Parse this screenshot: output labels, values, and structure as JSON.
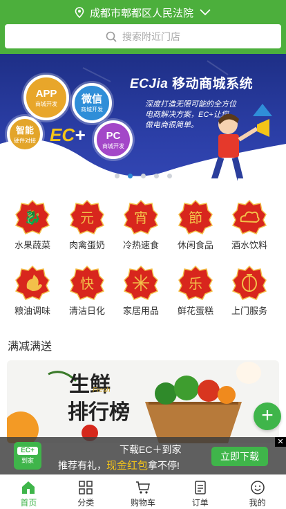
{
  "header": {
    "location": "成都市郫都区人民法院",
    "search_placeholder": "搜索附近门店"
  },
  "banner": {
    "brand": "ECJia",
    "title": "移动商城系统",
    "desc_line1": "深度打造无限可能的全方位",
    "desc_line2": "电商解决方案，EC+让您",
    "desc_line3": "做电商很简单。",
    "logo_text": "EC",
    "bubbles": [
      {
        "big": "APP",
        "small": "商城开发",
        "color": "#e8a62a"
      },
      {
        "big": "微信",
        "small": "商城开发",
        "color": "#2f8ed8"
      },
      {
        "big": "智能",
        "small": "硬件对接",
        "color": "#e3a52a"
      },
      {
        "big": "PC",
        "small": "商城开发",
        "color": "#a347c8"
      }
    ],
    "slide_count": 5,
    "active_slide": 1
  },
  "categories": [
    {
      "label": "水果蔬菜",
      "glyph": "🐉"
    },
    {
      "label": "肉禽蛋奶",
      "glyph": "元"
    },
    {
      "label": "冷热速食",
      "glyph": "宵"
    },
    {
      "label": "休闲食品",
      "glyph": "節"
    },
    {
      "label": "酒水饮料",
      "glyph": "☁"
    },
    {
      "label": "粮油调味",
      "glyph": "🐓"
    },
    {
      "label": "清洁日化",
      "glyph": "快"
    },
    {
      "label": "家居用品",
      "glyph": "✺"
    },
    {
      "label": "鲜花蛋糕",
      "glyph": "乐"
    },
    {
      "label": "上门服务",
      "glyph": "🏮"
    }
  ],
  "section": {
    "title": "满减满送",
    "promo_text1": "生鲜",
    "promo_text2": "排行榜",
    "promo_fresh": "Fresh"
  },
  "download_bar": {
    "line1": "下载EC＋到家",
    "line2_pre": "推荐有礼，",
    "line2_red": "现金红包",
    "line2_post": "拿不停!",
    "button": "立即下载",
    "logo_top": "EC+",
    "logo_bottom": "到家",
    "close": "✕"
  },
  "tabbar": [
    {
      "label": "首页",
      "icon": "home-icon",
      "active": true
    },
    {
      "label": "分类",
      "icon": "grid-icon",
      "active": false
    },
    {
      "label": "购物车",
      "icon": "cart-icon",
      "active": false
    },
    {
      "label": "订单",
      "icon": "order-icon",
      "active": false
    },
    {
      "label": "我的",
      "icon": "profile-icon",
      "active": false
    }
  ],
  "colors": {
    "brand_green": "#4caf3c",
    "banner_blue": "#1e2f86",
    "category_red": "#d8261d"
  }
}
